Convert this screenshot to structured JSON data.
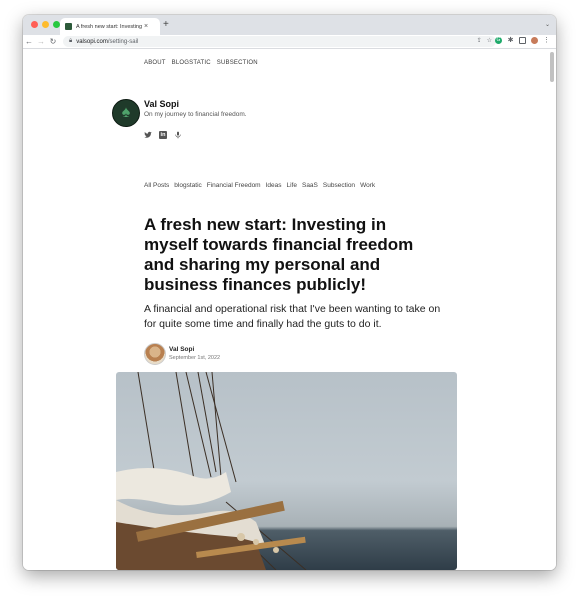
{
  "browser": {
    "tab_title": "A fresh new start: Investing in",
    "tab_close": "×",
    "new_tab": "+",
    "url_domain": "valsopi.com",
    "url_path": "/setting-sail",
    "colors": {
      "close": "#ff5f57",
      "minimize": "#febc2e",
      "maximize": "#28c840"
    }
  },
  "top_nav": [
    "ABOUT",
    "BLOGSTATIC",
    "SUBSECTION"
  ],
  "site": {
    "name": "Val Sopi",
    "tagline": "On my journey to financial freedom."
  },
  "social_icons": [
    "twitter-icon",
    "linkedin-icon",
    "podcast-icon"
  ],
  "categories": [
    "All Posts",
    "blogstatic",
    "Financial Freedom",
    "Ideas",
    "Life",
    "SaaS",
    "Subsection",
    "Work"
  ],
  "post": {
    "title": "A fresh new start: Investing in myself towards financial freedom and sharing my personal and business finances publicly!",
    "subtitle": "A financial and operational risk that I've been wanting to take on for quite some time and finally had the guts to do it.",
    "author": "Val Sopi",
    "date": "September 1st, 2022"
  }
}
